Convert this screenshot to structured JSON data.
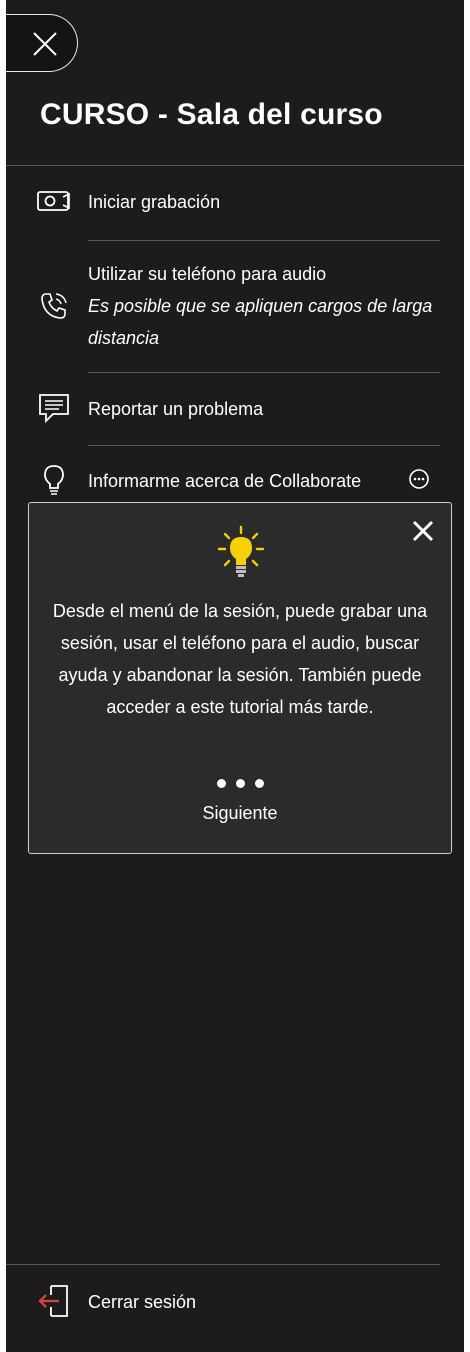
{
  "header": {
    "title": "CURSO - Sala del curso"
  },
  "menu": {
    "items": [
      {
        "label": "Iniciar grabación",
        "icon": "camera-record-icon"
      },
      {
        "label": "Utilizar su teléfono para audio",
        "sub": "Es posible que se apliquen cargos de larga distancia",
        "icon": "phone-icon"
      },
      {
        "label": "Reportar un problema",
        "icon": "report-icon"
      },
      {
        "label": "Informarme acerca de Collaborate",
        "icon": "lightbulb-icon"
      }
    ]
  },
  "tutorial": {
    "message": "Desde el menú de la sesión, puede grabar una sesión, usar el teléfono para el audio, buscar ayuda y abandonar la sesión. También puede acceder a este tutorial más tarde.",
    "next_label": "Siguiente",
    "step_count": 3
  },
  "footer": {
    "signout_label": "Cerrar sesión"
  },
  "colors": {
    "panel_bg": "#1c1c1c",
    "popup_bg": "#2b2b2b",
    "bulb": "#f5d100",
    "signout_icon": "#d9433f"
  }
}
